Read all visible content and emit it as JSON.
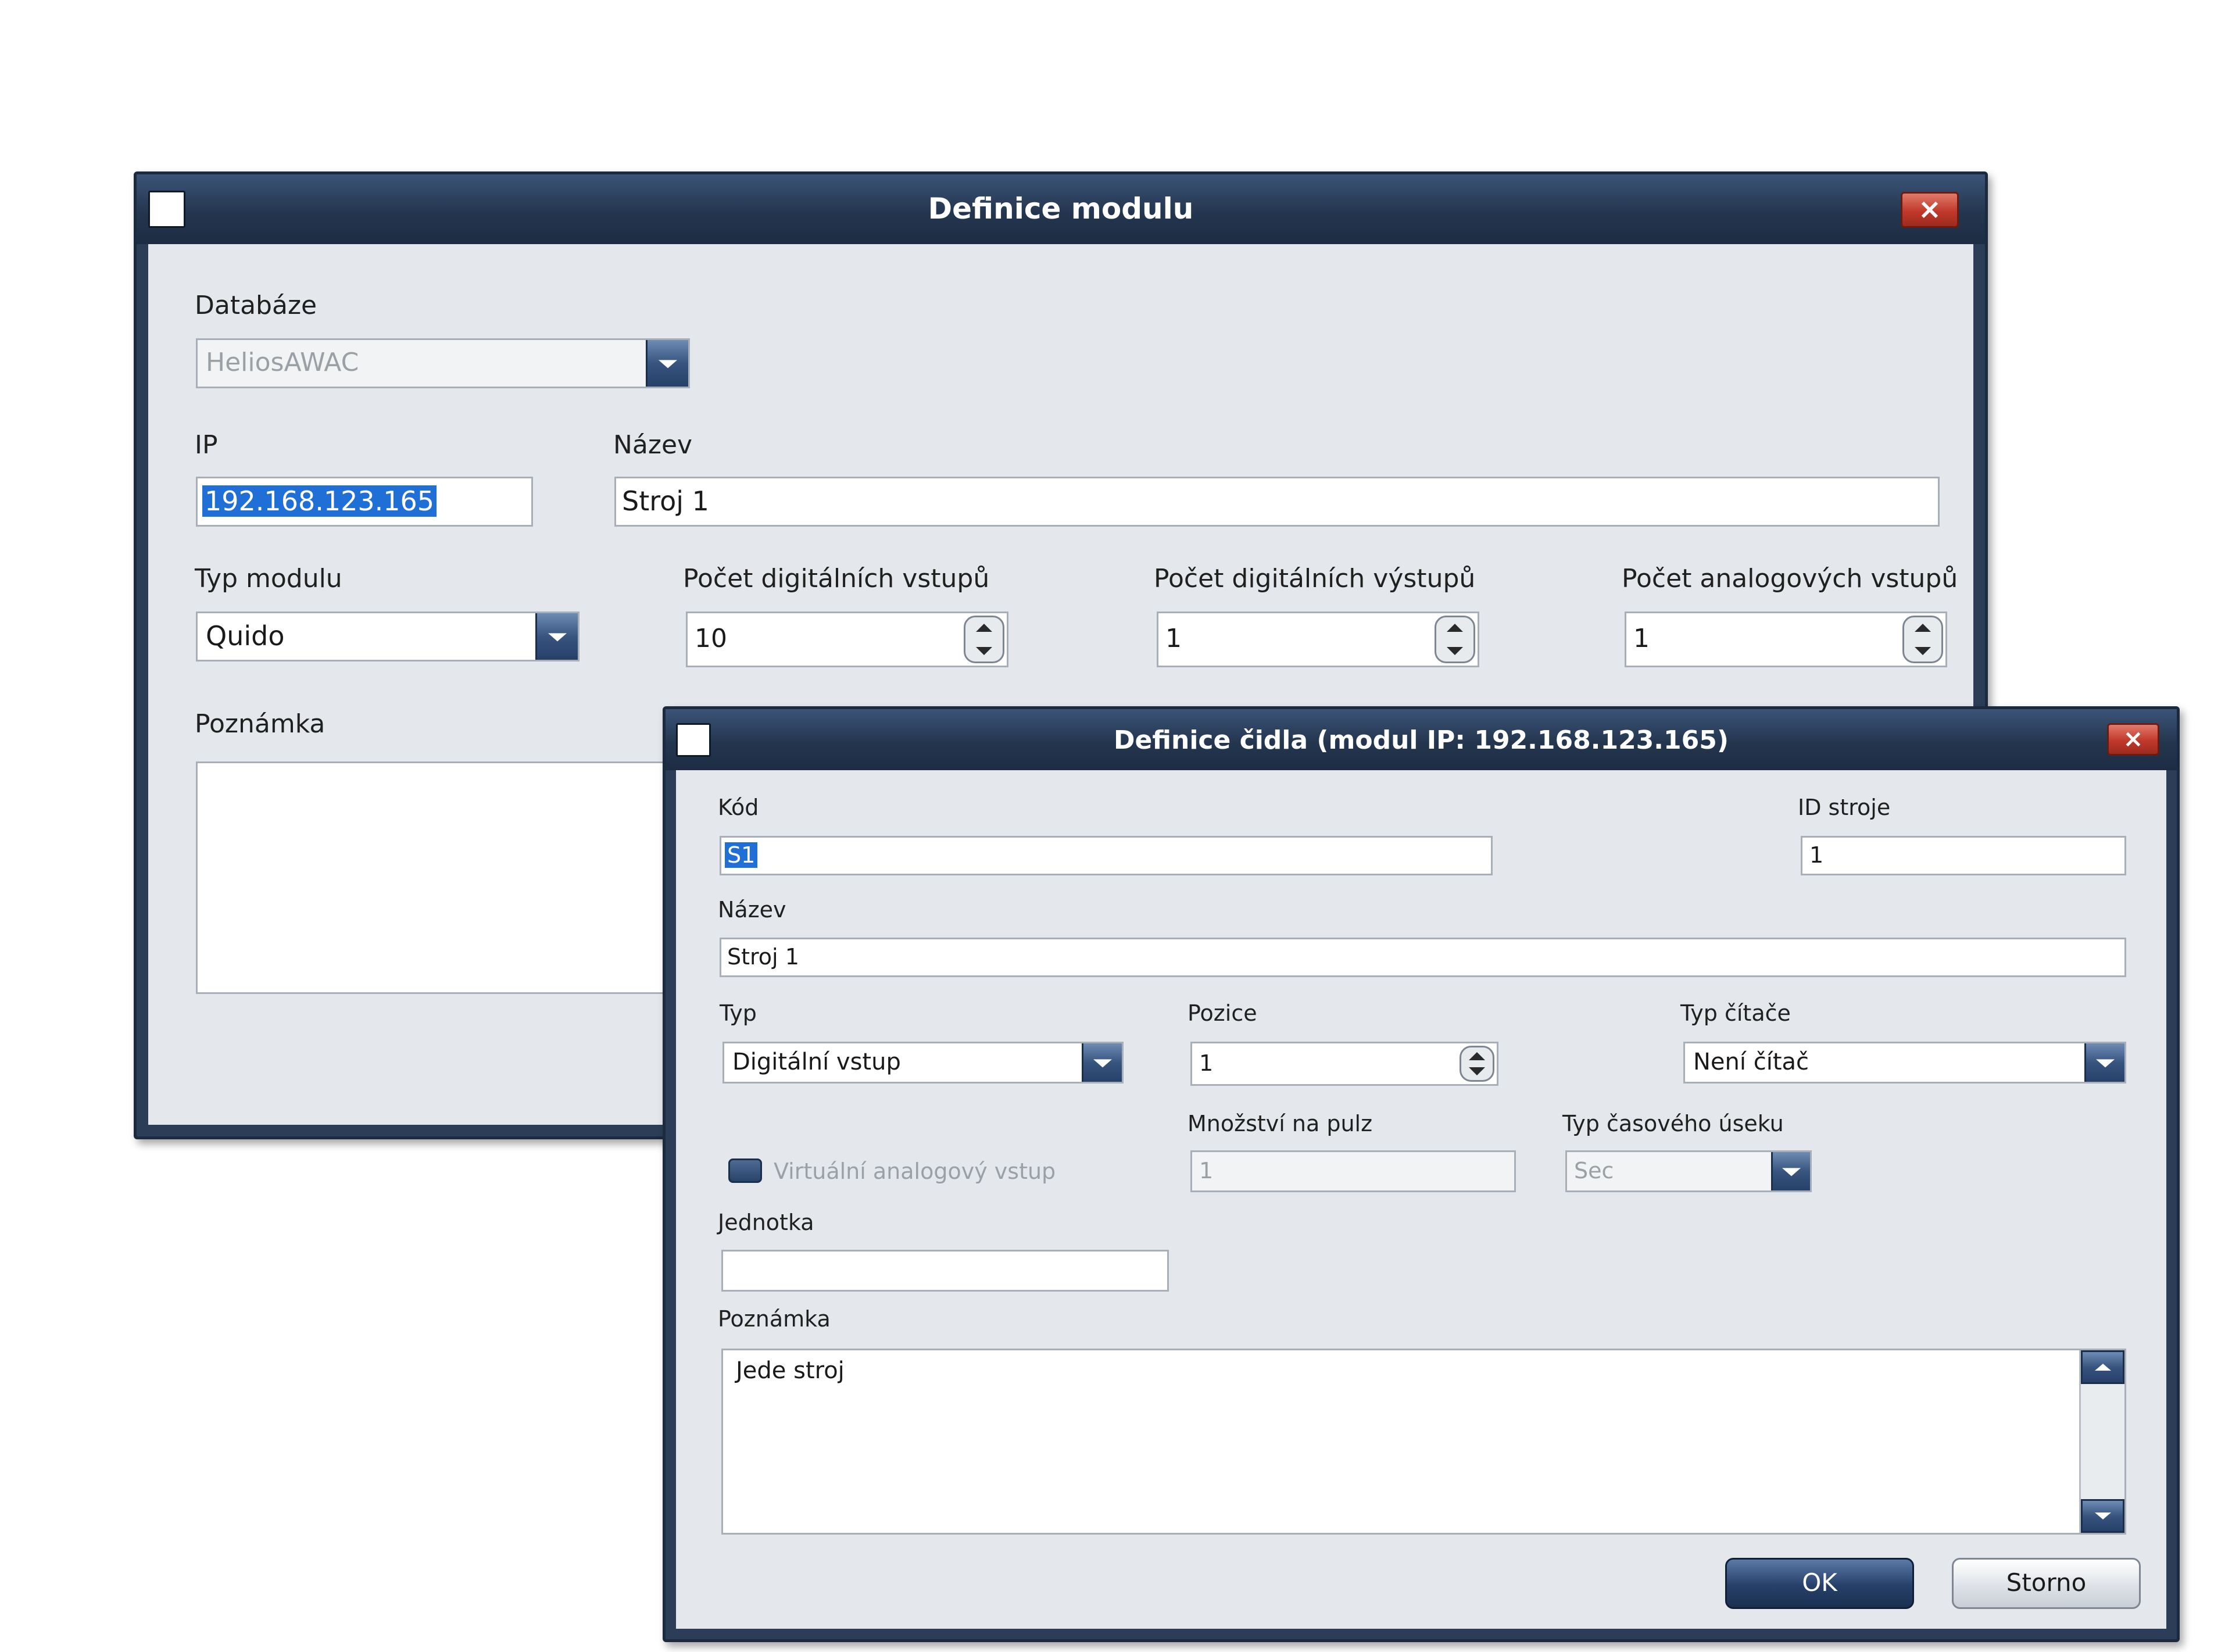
{
  "module_dialog": {
    "title": "Definice modulu",
    "close_glyph": "×",
    "database_label": "Databáze",
    "database_value": "HeliosAWAC",
    "ip_label": "IP",
    "ip_value": "192.168.123.165",
    "name_label": "Název",
    "name_value": "Stroj 1",
    "module_type_label": "Typ modulu",
    "module_type_value": "Quido",
    "digital_inputs_label": "Počet digitálních vstupů",
    "digital_inputs_value": "10",
    "digital_outputs_label": "Počet digitálních výstupů",
    "digital_outputs_value": "1",
    "analog_inputs_label": "Počet analogových vstupů",
    "analog_inputs_value": "1",
    "note_label": "Poznámka",
    "note_value": ""
  },
  "sensor_dialog": {
    "title": "Definice čidla (modul IP: 192.168.123.165)",
    "close_glyph": "×",
    "code_label": "Kód",
    "code_value": "S1",
    "machine_id_label": "ID stroje",
    "machine_id_value": "1",
    "name_label": "Název",
    "name_value": "Stroj 1",
    "type_label": "Typ",
    "type_value": "Digitální vstup",
    "position_label": "Pozice",
    "position_value": "1",
    "counter_type_label": "Typ čítače",
    "counter_type_value": "Není čítač",
    "amount_per_pulse_label": "Množství na pulz",
    "amount_per_pulse_value": "1",
    "time_period_label": "Typ časového úseku",
    "time_period_value": "Sec",
    "virtual_analog_label": "Virtuální analogový vstup",
    "unit_label": "Jednotka",
    "unit_value": "",
    "note_label": "Poznámka",
    "note_value": "Jede stroj",
    "ok_label": "OK",
    "cancel_label": "Storno"
  },
  "colors": {
    "window_frame": "#2b3d57",
    "title_text": "#ffffff",
    "close_button": "#c0392b",
    "client_bg": "#e4e8ec",
    "selection": "#1f6fd6",
    "ok_button": "#27406a"
  }
}
